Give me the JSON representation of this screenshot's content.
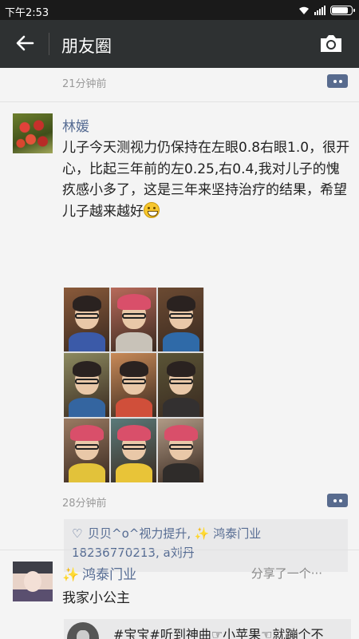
{
  "status_bar": {
    "time": "下午2:53",
    "battery_level": 0.9
  },
  "app_bar": {
    "title": "朋友圈",
    "back_icon": "back-arrow-icon",
    "camera_icon": "camera-icon"
  },
  "feed": {
    "top_post": {
      "time": "21分钟前"
    },
    "post1": {
      "author": "林媛",
      "text": "儿子今天测视力仍保持在左眼0.8右眼1.0，很开心，比起三年前的左0.25,右0.4,我对儿子的愧疚感小多了，这是三年来坚持治疗的结果，希望儿子越来越好",
      "emoji": "grinning-face-emoji",
      "photos": [
        {
          "hat": false,
          "bg": "#8a5a3a",
          "shirt": "#3b5aa8"
        },
        {
          "hat": true,
          "bg": "#b76a5a",
          "shirt": "#c8c2b8"
        },
        {
          "hat": false,
          "bg": "#6b4a32",
          "shirt": "#2f6aa8"
        },
        {
          "hat": false,
          "bg": "#8c8a60",
          "shirt": "#3465a0"
        },
        {
          "hat": false,
          "bg": "#c98a58",
          "shirt": "#d04f3a"
        },
        {
          "hat": false,
          "bg": "#5a5436",
          "shirt": "#333030"
        },
        {
          "hat": true,
          "bg": "#9a7a62",
          "shirt": "#e2c23a"
        },
        {
          "hat": true,
          "bg": "#5a7a7a",
          "shirt": "#e8c438"
        },
        {
          "hat": true,
          "bg": "#b09a86",
          "shirt": "#2f2c2a"
        }
      ],
      "time": "28分钟前",
      "likes_line1": "贝贝^o^视力提升, ✨ 鸿泰门业",
      "likes_line2": "18236770213, a刘丹"
    },
    "post2": {
      "author": "鸿泰门业",
      "share_label": "分享了一个···",
      "text": "我家小公主",
      "link_title": "#宝宝#听到神曲☞小苹果☜就蹦个不"
    }
  },
  "colors": {
    "link_blue": "#566c93",
    "appbar": "#2e3132",
    "statusbar": "#1a1a1a"
  }
}
